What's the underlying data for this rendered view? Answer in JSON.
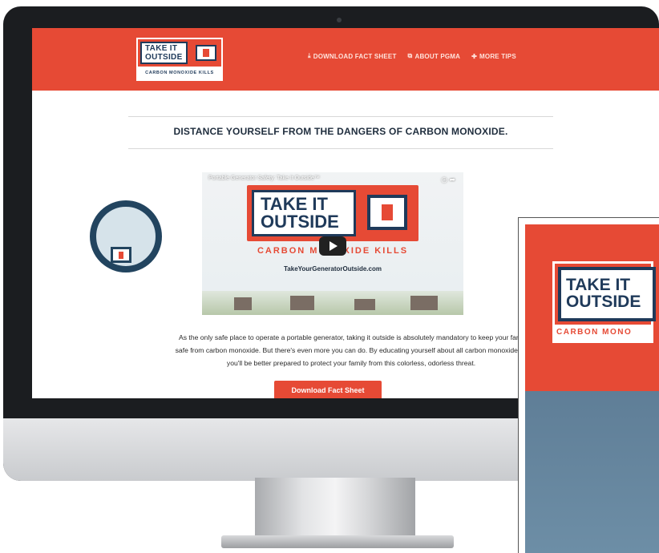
{
  "site": {
    "logo": {
      "line1": "TAKE IT",
      "line2": "OUTSIDE",
      "tagline": "CARBON MONOXIDE KILLS"
    },
    "nav": [
      {
        "icon": "download-icon",
        "label": "DOWNLOAD FACT SHEET"
      },
      {
        "icon": "external-link-icon",
        "label": "ABOUT PGMA"
      },
      {
        "icon": "plus-icon",
        "label": "MORE TIPS"
      }
    ],
    "headline": "DISTANCE YOURSELF FROM THE DANGERS OF CARBON MONOXIDE.",
    "video": {
      "title": "Portable Generator Safety: Take It Outside™",
      "logo_line1": "TAKE IT",
      "logo_line2": "OUTSIDE",
      "tagline": "CARBON MONOXIDE KILLS",
      "url": "TakeYourGeneratorOutside.com",
      "icons": [
        "clock-icon",
        "share-icon"
      ]
    },
    "body_lines": [
      "As the only safe place to operate a portable generator, taking it outside is absolutely mandatory to keep your fami",
      "safe from carbon monoxide. But there's even more you can do. By educating yourself about all carbon monoxide ris",
      "you'll be better prepared to protect your family from this colorless, odorless threat."
    ],
    "cta_label": "Download Fact Sheet"
  },
  "mobile": {
    "logo_line1": "TAKE IT",
    "logo_line2": "OUTSIDE",
    "tagline": "CARBON MONO"
  },
  "colors": {
    "brand_red": "#e64a35",
    "navy": "#1f3a5a",
    "mobile_blue": "#6787a0"
  }
}
